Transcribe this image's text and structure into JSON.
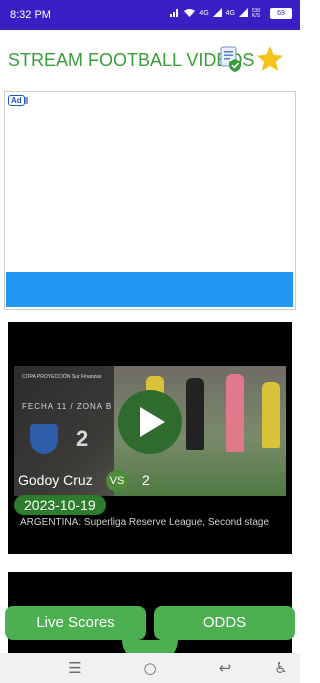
{
  "status_bar": {
    "time": "8:32 PM",
    "battery": "69",
    "network_1": "4G",
    "network_2": "4G",
    "speed": "530 K/S"
  },
  "header": {
    "title": "STREAM FOOTBALL VIDEOS",
    "doc_icon": "document-check-icon",
    "star_icon": "star-icon"
  },
  "ad": {
    "badge": "Ad"
  },
  "match": {
    "home_team": "Godoy Cruz",
    "vs_label": "VS",
    "away_team": "2",
    "date": "2023-10-19",
    "competition": "ARGENTINA: Superliga Reserve League, Second stage",
    "thumbnail": {
      "league": "COPA PROYECCIÓN Sur Finanzas",
      "fecha": "FECHA 11 / ZONA B",
      "score": "2"
    }
  },
  "buttons": {
    "live_scores": "Live Scores",
    "odds": "ODDS"
  },
  "nav": {
    "menu_icon": "☰",
    "home_icon": "○",
    "back_icon": "↩",
    "accessibility_icon": "♿"
  },
  "colors": {
    "status_bar": "#3b1fc4",
    "accent_green": "#4caf50",
    "title_green": "#3a9d3a",
    "ad_blue": "#2196f3"
  }
}
